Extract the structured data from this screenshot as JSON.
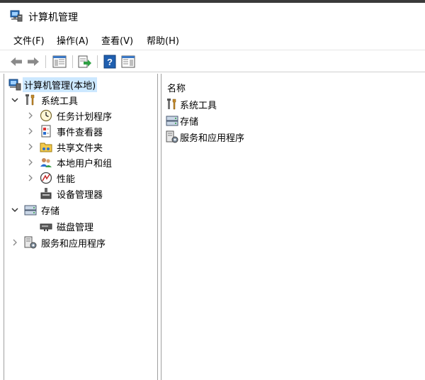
{
  "window": {
    "title": "计算机管理"
  },
  "menubar": {
    "items": [
      "文件(F)",
      "操作(A)",
      "查看(V)",
      "帮助(H)"
    ]
  },
  "toolbar": {
    "buttons": [
      "back-icon",
      "forward-icon",
      "show-hide-console-tree-icon",
      "export-list-icon",
      "help-icon",
      "show-hide-action-pane-icon"
    ]
  },
  "tree": {
    "root": "计算机管理(本地)",
    "system_tools": "系统工具",
    "task_scheduler": "任务计划程序",
    "event_viewer": "事件查看器",
    "shared_folders": "共享文件夹",
    "local_users_groups": "本地用户和组",
    "performance": "性能",
    "device_manager": "设备管理器",
    "storage": "存储",
    "disk_management": "磁盘管理",
    "services_apps": "服务和应用程序"
  },
  "list": {
    "header": "名称",
    "items": [
      "系统工具",
      "存储",
      "服务和应用程序"
    ]
  }
}
